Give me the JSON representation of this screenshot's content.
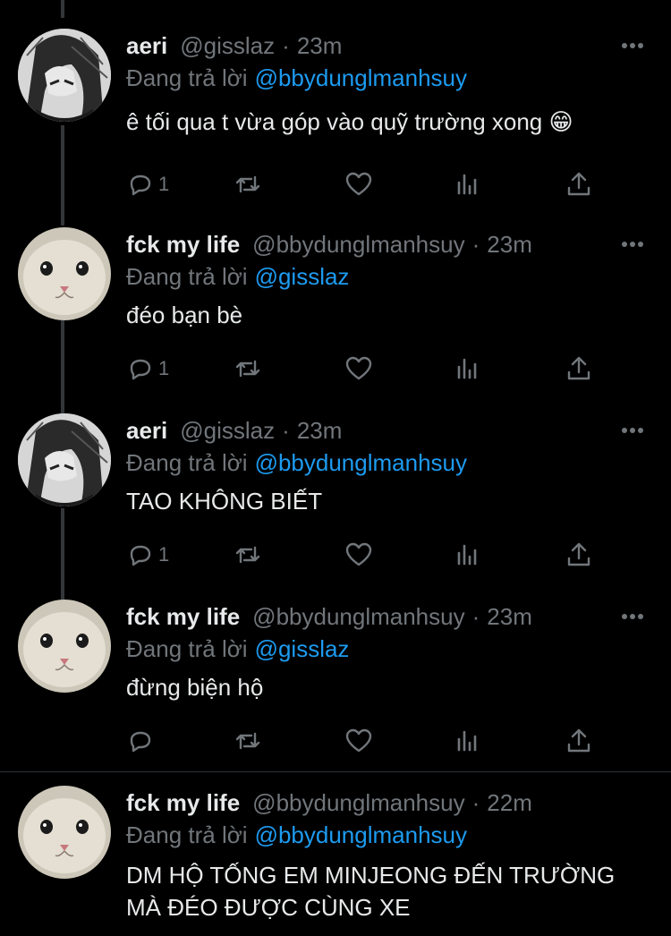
{
  "colors": {
    "background": "#000000",
    "text": "#e7e9ea",
    "muted": "#71767b",
    "link": "#1d9bf0"
  },
  "replying_label": "Đang trả lời",
  "tweets": [
    {
      "name": "aeri",
      "handle": "@gisslaz",
      "time": "23m",
      "replying_to": "@bbydunglmanhsuy",
      "text": "ê tối qua t vừa góp vào quỹ trường xong 😁",
      "reply_count": "1",
      "avatar": "aeri-avatar"
    },
    {
      "name": "fck my life",
      "handle": "@bbydunglmanhsuy",
      "time": "23m",
      "replying_to": "@gisslaz",
      "text": "đéo bạn bè",
      "reply_count": "1",
      "avatar": "cat-avatar"
    },
    {
      "name": "aeri",
      "handle": "@gisslaz",
      "time": "23m",
      "replying_to": "@bbydunglmanhsuy",
      "text": "TAO KHÔNG BIẾT",
      "reply_count": "1",
      "avatar": "aeri-avatar"
    },
    {
      "name": "fck my life",
      "handle": "@bbydunglmanhsuy",
      "time": "23m",
      "replying_to": "@gisslaz",
      "text": "đừng biện hộ",
      "reply_count": "",
      "avatar": "cat-avatar"
    },
    {
      "name": "fck my life",
      "handle": "@bbydunglmanhsuy",
      "time": "22m",
      "replying_to": "@bbydunglmanhsuy",
      "text": "DM HỘ TỐNG EM MINJEONG ĐẾN TRƯỜNG MÀ ĐÉO ĐƯỢC CÙNG XE",
      "reply_count": "",
      "avatar": "cat-avatar"
    }
  ],
  "icons": [
    "reply-icon",
    "retweet-icon",
    "like-icon",
    "analytics-icon",
    "share-icon",
    "more-icon"
  ]
}
